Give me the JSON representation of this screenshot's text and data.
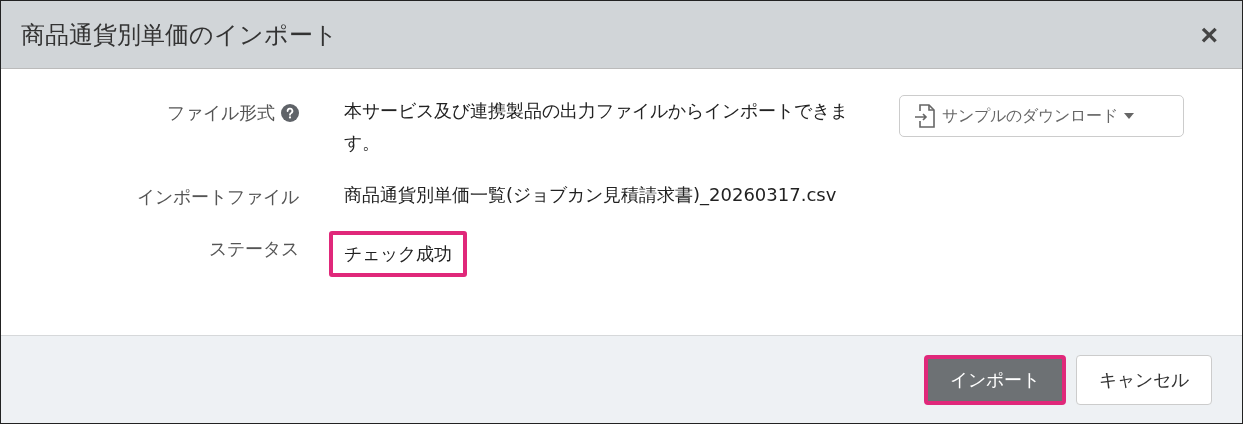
{
  "dialog": {
    "title": "商品通貨別単価のインポート",
    "close": "×"
  },
  "fields": [
    {
      "kind": "help",
      "label": "ファイル形式",
      "text": "本サービス及び連携製品の出力ファイルからインポートできます。",
      "highlighted": false
    },
    {
      "kind": "plain",
      "label": "インポートファイル",
      "text": "商品通貨別単価一覧(ジョブカン見積請求書)_20260317.csv",
      "highlighted": false
    },
    {
      "kind": "plain",
      "label": "ステータス",
      "text": "チェック成功",
      "highlighted": true
    }
  ],
  "sample_button": {
    "label": "サンプルのダウンロード"
  },
  "buttons": [
    {
      "kind": "primary",
      "label": "インポート",
      "highlighted": true
    },
    {
      "kind": "secondary",
      "label": "キャンセル",
      "highlighted": false
    }
  ]
}
